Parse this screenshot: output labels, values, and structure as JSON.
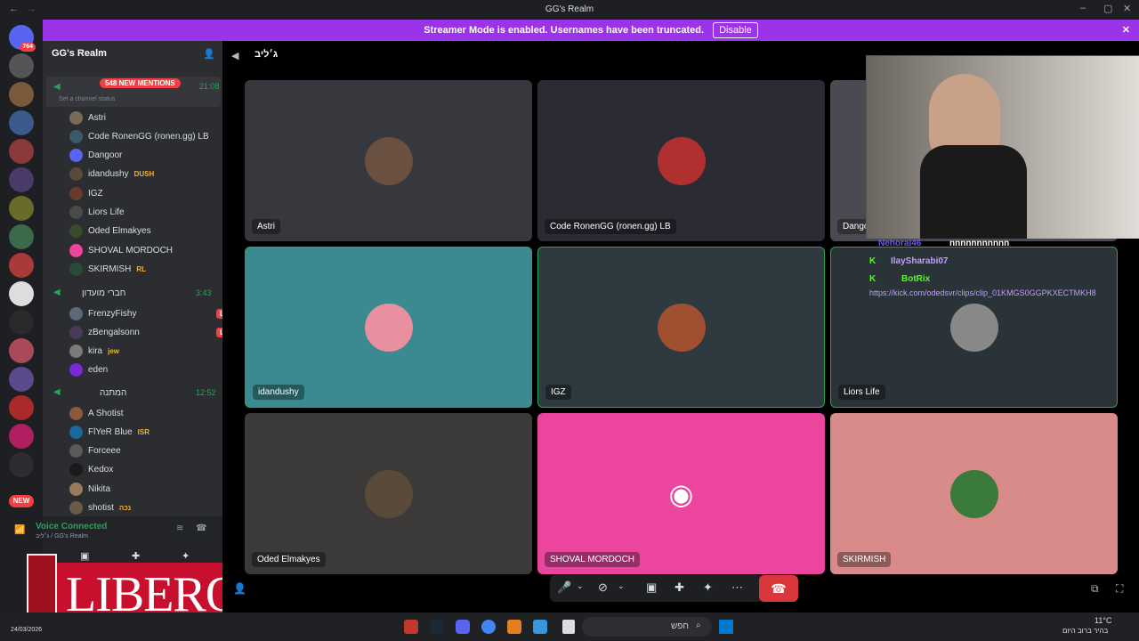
{
  "window": {
    "title": "GG's Realm"
  },
  "banner": {
    "text": "Streamer Mode is enabled. Usernames have been truncated.",
    "button": "Disable"
  },
  "guilds": {
    "home_badge": "764",
    "new_label": "NEW"
  },
  "server": {
    "name": "GG's Realm"
  },
  "channel1": {
    "name": "ג׳ליב",
    "mentions": "548 NEW MENTIONS",
    "time": "21:08",
    "status": "Set a channel status"
  },
  "members1": [
    {
      "name": "Astri",
      "color": "#7a6a58"
    },
    {
      "name": "Code RonenGG (ronen.gg) LB",
      "color": "#3a5a6a"
    },
    {
      "name": "Dangoor",
      "color": "#5865f2"
    },
    {
      "name": "idandushy",
      "tag": "DUSH",
      "color": "#5a4a3a"
    },
    {
      "name": "IGZ",
      "color": "#6a3a2a"
    },
    {
      "name": "Liors Life",
      "color": "#4a4a4a"
    },
    {
      "name": "Oded Elmakyes",
      "color": "#3a4a2a"
    },
    {
      "name": "SHOVAL MORDOCH",
      "color": "#eb459e"
    },
    {
      "name": "SKIRMISH",
      "tag": "RL",
      "color": "#2a4a3a"
    }
  ],
  "channel2": {
    "name": "חברי מועדון",
    "time": "3:43"
  },
  "members2": [
    {
      "name": "FrenzyFishy",
      "live": "LIVE",
      "color": "#5a6a7a"
    },
    {
      "name": "zBengalsonn",
      "live": "LIVE",
      "color": "#4a3a5a"
    },
    {
      "name": "kira",
      "tag": "jew",
      "color": "#7a7a7a"
    },
    {
      "name": "eden",
      "color": "#7a2ad0"
    }
  ],
  "channel3": {
    "name": "המתנה",
    "time": "12:52"
  },
  "members3": [
    {
      "name": "A Shotist",
      "color": "#8a5a3a"
    },
    {
      "name": "FlYeR Blue",
      "tag": "ISR",
      "color": "#1a6aa0"
    },
    {
      "name": "Forceee",
      "color": "#5a5a5a"
    },
    {
      "name": "Kedox",
      "color": "#1a1a1a"
    },
    {
      "name": "Nikita",
      "color": "#9a7a5a"
    },
    {
      "name": "shotist",
      "tag": "נכה",
      "color": "#6a5a4a"
    }
  ],
  "voice": {
    "status": "Voice Connected",
    "channel": "ג׳ליב / GG's Realm"
  },
  "overlay": {
    "brand": "LIBERO"
  },
  "stage": {
    "channel": "ג׳ליב"
  },
  "tiles": [
    {
      "name": "Astri",
      "bg": "#37383d",
      "av": "#6a5040"
    },
    {
      "name": "Code RonenGG (ronen.gg) LB",
      "bg": "#2a2b33",
      "av": "#b03030"
    },
    {
      "name": "Dango",
      "bg": "#4a4b52",
      "av": "#555"
    },
    {
      "name": "idandushy",
      "bg": "#3a8a90",
      "av": "#e890a0"
    },
    {
      "name": "IGZ",
      "bg": "#2f3a40",
      "av": "#a05030"
    },
    {
      "name": "Liors Life",
      "bg": "#2a3438",
      "av": "#888"
    },
    {
      "name": "Oded Elmakyes",
      "bg": "#3c3a38",
      "av": "#5a4a3a"
    },
    {
      "name": "SHOVAL MORDOCH",
      "bg": "#eb459e",
      "av": "#eb459e"
    },
    {
      "name": "SKIRMISH",
      "bg": "#d98a8a",
      "av": "#3a7a3a"
    }
  ],
  "chat": [
    {
      "user": "Nehorai46",
      "msg": "nnnnnnnnnnn"
    },
    {
      "user": "IlaySharabi07",
      "msg": ""
    },
    {
      "user": "BotRix",
      "msg": ""
    }
  ],
  "chat_link": "https://kick.com/odedsvr/clips/clip_01KMGS0GGPKXECTMKH8",
  "taskbar": {
    "search": "חפש",
    "temp": "11°C",
    "weather": "בהיר ברוב היום",
    "date": "24/03/2026"
  }
}
